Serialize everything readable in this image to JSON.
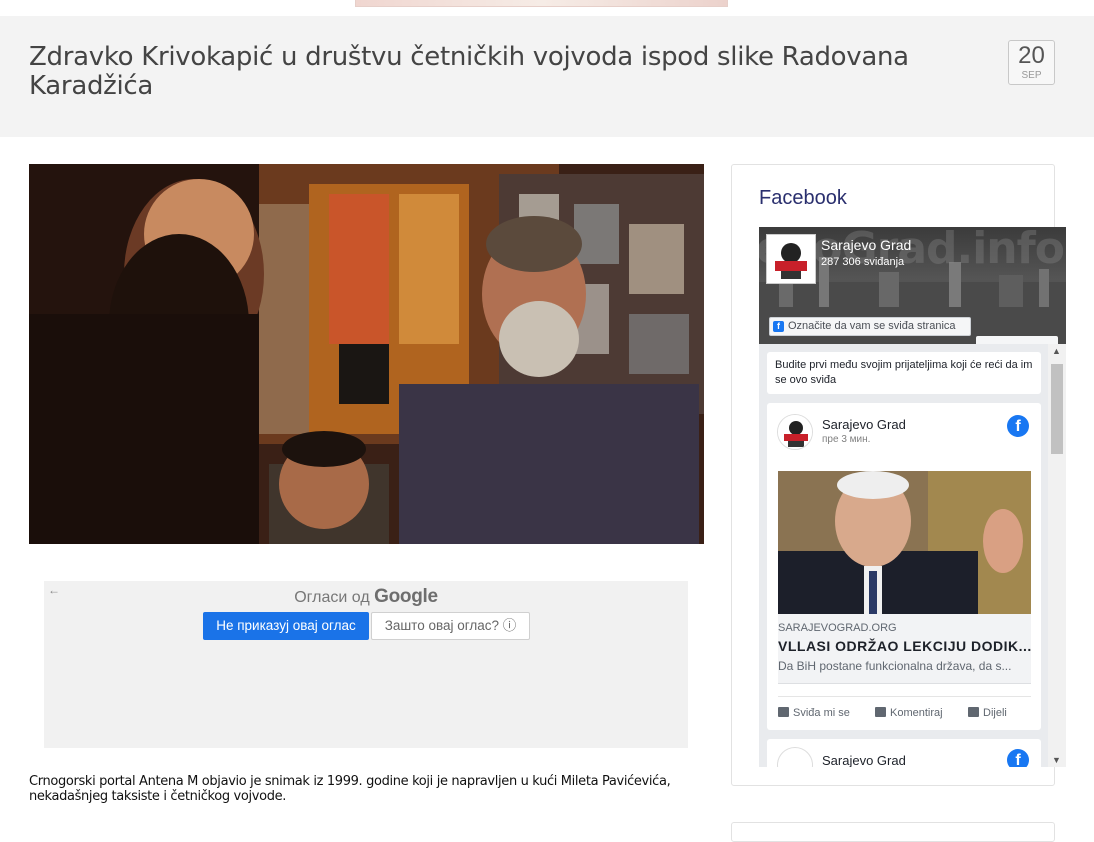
{
  "post": {
    "title": "Zdravko Krivokapić u društvu četničkih vojvoda ispod slike Radovana Karadžića",
    "date_day": "20",
    "date_month": "SEP",
    "body": "Crnogorski portal Antena M objavio je snimak iz 1999. godine koji je napravljen u kući Mileta Pavićevića, nekadašnjeg taksiste i četničkog vojvode."
  },
  "ad": {
    "back_glyph": "←",
    "title_prefix": "Огласи од",
    "title_brand": "Google",
    "stop_button": "Не приказуј овај оглас",
    "why_button": "Зашто овај оглас? ⓘ"
  },
  "sidebar": {
    "widget_title": "Facebook",
    "page_name": "Sarajevo Grad",
    "likes": "287 306 sviđanja",
    "cover_text": "evoGrad.info",
    "like_button": "Označite da vam se sviđa stranica",
    "friends_prompt": "Budite prvi među svojim prijateljima koji će reći da im se ovo sviđa",
    "post": {
      "author": "Sarajevo Grad",
      "time": "пре 3 мин.",
      "link_domain": "SARAJEVOGRAD.ORG",
      "link_title": "VLLASI ODRŽAO LEKCIJU DODIK...",
      "link_desc": "Da BiH postane funkcionalna država, da s...",
      "action_like": "Sviđa mi se",
      "action_comment": "Komentiraj",
      "action_share": "Dijeli"
    },
    "next_post_author": "Sarajevo Grad",
    "colors": {
      "facebook_blue": "#1877f2",
      "title_color": "#2a2f6e",
      "ad_button": "#1a73e8"
    }
  }
}
